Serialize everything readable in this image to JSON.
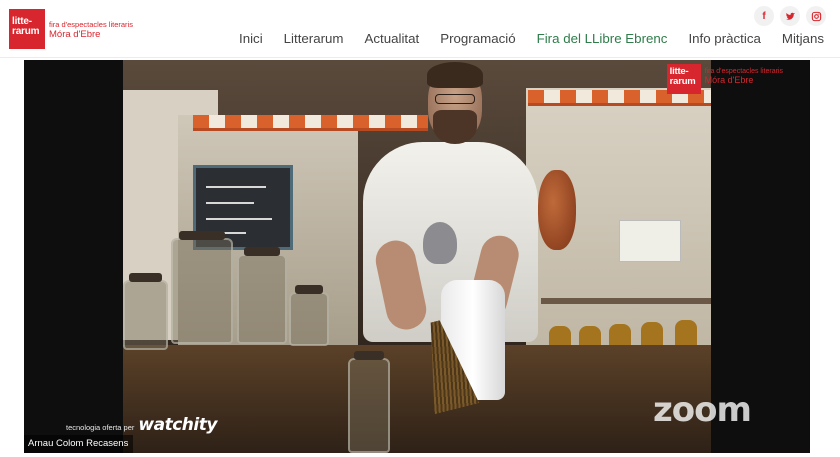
{
  "header": {
    "logo": {
      "mark_line1": "litte-",
      "mark_line2": "rarum",
      "tagline": "fira d'espectacles literaris",
      "place": "Móra d'Ebre"
    },
    "nav": [
      {
        "label": "Inici"
      },
      {
        "label": "Litterarum"
      },
      {
        "label": "Actualitat"
      },
      {
        "label": "Programació"
      },
      {
        "label": "Fira del LLibre Ebrenc",
        "active": true
      },
      {
        "label": "Info pràctica"
      },
      {
        "label": "Mitjans"
      }
    ],
    "social": [
      {
        "icon": "facebook-icon",
        "glyph": "f"
      },
      {
        "icon": "twitter-icon",
        "glyph": ""
      },
      {
        "icon": "instagram-icon",
        "glyph": ""
      }
    ]
  },
  "video": {
    "overlay_logo": {
      "mark_line1": "litte-",
      "mark_line2": "rarum",
      "tagline": "fira d'espectacles literaris",
      "place": "Móra d'Ebre"
    },
    "tech_credit_prefix": "tecnologia oferta per",
    "tech_credit_brand": "watchity",
    "speaker_name": "Arnau Colom Recasens",
    "platform_mark": "zoom"
  },
  "colors": {
    "brand_red": "#d7262e",
    "nav_text": "#444444",
    "nav_active": "#2e7d4a"
  }
}
